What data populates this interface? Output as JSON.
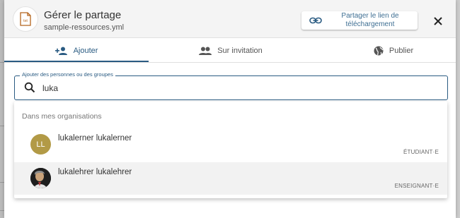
{
  "dialog": {
    "title": "Gérer le partage",
    "filename": "sample-ressources.yml",
    "file_type_badge": "txt",
    "file_icon": "file-text-icon",
    "share_link_button": "Partager le lien de téléchargement",
    "share_link_icon": "link-icon",
    "close_icon": "close-icon"
  },
  "tabs": [
    {
      "label": "Ajouter",
      "icon": "person-add-icon",
      "active": true
    },
    {
      "label": "Sur invitation",
      "icon": "people-icon",
      "active": false
    },
    {
      "label": "Publier",
      "icon": "globe-icon",
      "active": false
    }
  ],
  "search": {
    "label": "Ajouter des personnes ou des groupes",
    "value": "luka",
    "icon": "search-icon"
  },
  "results": {
    "group_header": "Dans mes organisations",
    "items": [
      {
        "name": "lukalerner lukalerner",
        "role": "ÉTUDIANT·E",
        "avatar_initials": "LL",
        "avatar_type": "initials"
      },
      {
        "name": "lukalehrer lukalehrer",
        "role": "ENSEIGNANT·E",
        "avatar_type": "photo"
      }
    ]
  },
  "colors": {
    "accent": "#2a5b82",
    "avatar_initials_bg": "#b29a46",
    "file_icon": "#b5651d"
  }
}
